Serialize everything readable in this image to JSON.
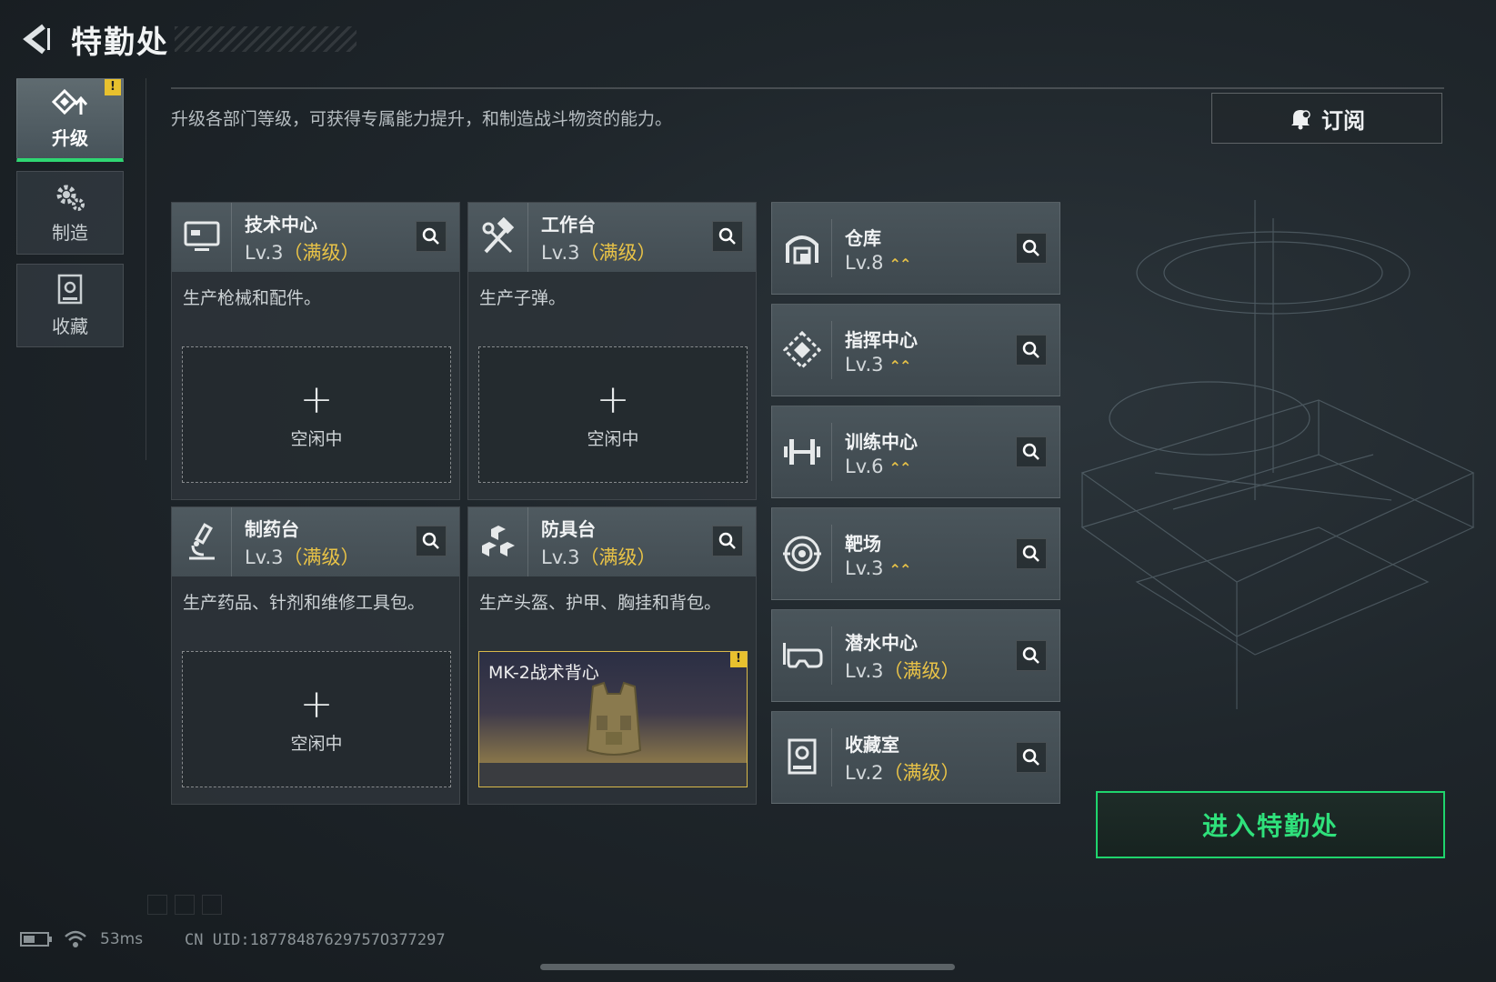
{
  "header": {
    "title": "特勤处"
  },
  "sidebar": {
    "items": [
      {
        "label": "升级",
        "active": true,
        "badge": "!"
      },
      {
        "label": "制造",
        "active": false
      },
      {
        "label": "收藏",
        "active": false
      }
    ]
  },
  "description": "升级各部门等级，可获得专属能力提升，和制造战斗物资的能力。",
  "subscribe": {
    "label": "订阅"
  },
  "workshops": [
    {
      "name": "技术中心",
      "level": "Lv.3",
      "max": "（满级）",
      "desc": "生产枪械和配件。",
      "slot": {
        "plus": "+",
        "status": "空闲中"
      }
    },
    {
      "name": "工作台",
      "level": "Lv.3",
      "max": "（满级）",
      "desc": "生产子弹。",
      "slot": {
        "plus": "+",
        "status": "空闲中"
      }
    },
    {
      "name": "制药台",
      "level": "Lv.3",
      "max": "（满级）",
      "desc": "生产药品、针剂和维修工具包。",
      "slot": {
        "plus": "+",
        "status": "空闲中"
      }
    },
    {
      "name": "防具台",
      "level": "Lv.3",
      "max": "（满级）",
      "desc": "生产头盔、护甲、胸挂和背包。",
      "slot": {
        "item": "MK-2战术背心",
        "badge": "!"
      }
    }
  ],
  "facilities": [
    {
      "name": "仓库",
      "level": "Lv.8",
      "max": "",
      "upgradable": "⌃⌃"
    },
    {
      "name": "指挥中心",
      "level": "Lv.3",
      "max": "",
      "upgradable": "⌃⌃"
    },
    {
      "name": "训练中心",
      "level": "Lv.6",
      "max": "",
      "upgradable": "⌃⌃"
    },
    {
      "name": "靶场",
      "level": "Lv.3",
      "max": "",
      "upgradable": "⌃⌃"
    },
    {
      "name": "潜水中心",
      "level": "Lv.3",
      "max": "（满级）",
      "upgradable": ""
    },
    {
      "name": "收藏室",
      "level": "Lv.2",
      "max": "（满级）",
      "upgradable": ""
    }
  ],
  "enter_button": {
    "label": "进入特勤处"
  },
  "status": {
    "ping": "53ms",
    "uid": "CN UID:18778487629757O377297"
  },
  "colors": {
    "accent_green": "#2fe07b",
    "max_level_gold": "#e9c347",
    "alert_yellow": "#e8c12e"
  }
}
